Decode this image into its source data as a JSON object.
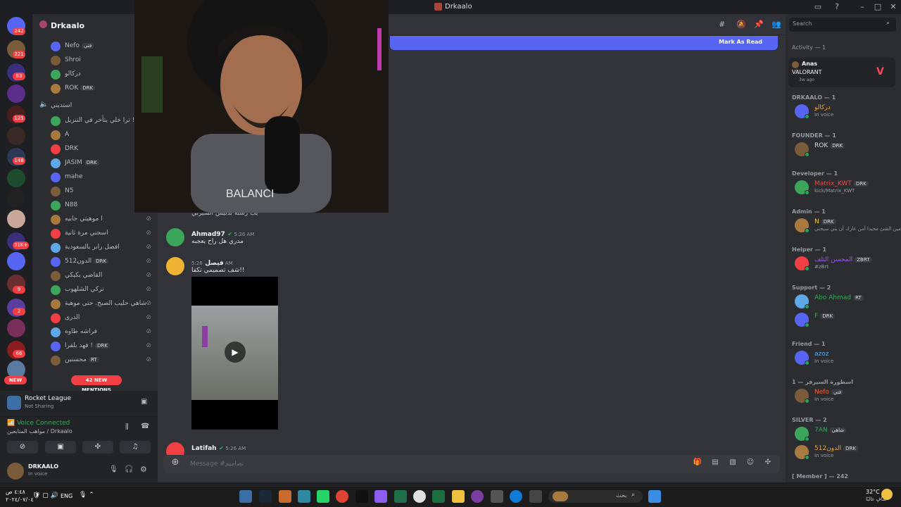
{
  "window": {
    "title": "Drkaalo",
    "minimize": "–",
    "maximize": "□",
    "close": "✕"
  },
  "rail": {
    "home_badge": "242",
    "badges": [
      "221",
      "83",
      "125",
      "148",
      "31K+",
      "9",
      "2",
      "66"
    ],
    "new_label": "NEW",
    "mentions_label": "42 NEW MENTIONS"
  },
  "sidebar": {
    "guild_name": "Drkaalo",
    "top_users": [
      {
        "name": "Nefo",
        "tag": "فتي"
      },
      {
        "name": "Shroi",
        "tag": ""
      },
      {
        "name": "دركالو",
        "tag": ""
      },
      {
        "name": "ROK",
        "tag": "DRK"
      }
    ],
    "voice_channel": "استديني",
    "voice_users": [
      {
        "name": "ترا خلي يتأخر في التنزيل !",
        "tag": "RT",
        "muted": false
      },
      {
        "name": "A",
        "tag": "",
        "muted": false
      },
      {
        "name": "DRK",
        "tag": "",
        "muted": false
      },
      {
        "name": "JASIM",
        "tag": "DRK",
        "muted": false
      },
      {
        "name": "mahe",
        "tag": "",
        "muted": false
      },
      {
        "name": "N5",
        "tag": "",
        "muted": false
      },
      {
        "name": "N88",
        "tag": "",
        "muted": false
      },
      {
        "name": "ا موهيتي حابيه",
        "tag": "",
        "muted": true
      },
      {
        "name": "اسجني مرة ثانية",
        "tag": "",
        "muted": true
      },
      {
        "name": "افضل رابر بالسعودية",
        "tag": "",
        "muted": true
      },
      {
        "name": "الدون512",
        "tag": "DRK",
        "muted": true
      },
      {
        "name": "القاضي بكيكي",
        "tag": "",
        "muted": true
      },
      {
        "name": "تركي الشلهوب",
        "tag": "",
        "muted": true
      },
      {
        "name": "شاهي حليب الصبح. حتى موهية",
        "tag": "",
        "muted": true
      },
      {
        "name": "الدرى",
        "tag": "",
        "muted": true
      },
      {
        "name": "فراشه طاوه",
        "tag": "",
        "muted": true
      },
      {
        "name": "فهد بلقرا !",
        "tag": "DRK",
        "muted": true
      },
      {
        "name": "محسنين",
        "tag": "RT",
        "muted": true
      }
    ],
    "activity_panel": {
      "game": "Rocket League",
      "status": "Not Sharing"
    },
    "voice_panel": {
      "status": "Voice Connected",
      "channel": "مواهب المتابعين / Drkaalo"
    },
    "user_panel": {
      "name": "DRKAALO",
      "status": "In voice"
    }
  },
  "chat": {
    "mark_as_read": "Mark As Read",
    "partial_text": "يب رشنة بدليس السيرني",
    "messages": [
      {
        "author": "Ahmad97",
        "time": "5:26 AM",
        "text": "مدري هل راح يعجبه"
      },
      {
        "author": "فيصل",
        "time": "5:26 AM",
        "text": "شف تصميمي تكفا!!"
      },
      {
        "author": "Latifah",
        "time": "5:26 AM",
        "text": ""
      }
    ],
    "composer_placeholder": "Message #تصاميم"
  },
  "members": {
    "search_placeholder": "Search",
    "activity_header": "Activity — 1",
    "activity": {
      "name": "Anas",
      "game": "VALORANT",
      "time": "3w ago"
    },
    "groups": [
      {
        "header": "DRKAALO — 1",
        "members": [
          {
            "name": "دركالو",
            "sub": "In voice",
            "color": "#f0a33a",
            "tag": ""
          }
        ]
      },
      {
        "header": "FOUNDER — 1",
        "members": [
          {
            "name": "ROK",
            "sub": "",
            "color": "#dbdee1",
            "tag": "DRK"
          }
        ]
      },
      {
        "header": "Developer — 1",
        "members": [
          {
            "name": "Matrix_KWT",
            "sub": "kick/Matrix_KWT",
            "color": "#e84a4a",
            "tag": "DRK"
          }
        ]
      },
      {
        "header": "Admin — 1",
        "members": [
          {
            "name": "N",
            "sub": "مين الشئ مجيدا أمن عارك أن يني سيحني",
            "color": "#f0d33a",
            "tag": "DRK"
          }
        ]
      },
      {
        "header": "Helper — 1",
        "members": [
          {
            "name": "المحسن التلف",
            "sub": "#zBrt",
            "color": "#9b59f0",
            "tag": "ZBRT"
          }
        ]
      },
      {
        "header": "Support — 2",
        "members": [
          {
            "name": "Abo Ahmad",
            "sub": "",
            "color": "#3ba55c",
            "tag": "RT"
          },
          {
            "name": "F",
            "sub": "",
            "color": "#3ba55c",
            "tag": "DRK"
          }
        ]
      },
      {
        "header": "Friend — 1",
        "members": [
          {
            "name": "azoz",
            "sub": "In voice",
            "color": "#5fa8e8",
            "tag": ""
          }
        ]
      },
      {
        "header": "اسطورة السيرفر — 1",
        "members": [
          {
            "name": "Nefo",
            "sub": "In voice",
            "color": "#e8643a",
            "tag": "فتي"
          }
        ]
      },
      {
        "header": "SILVER — 2",
        "members": [
          {
            "name": "7AN",
            "sub": "",
            "color": "#3ba55c",
            "tag": "شاهي"
          },
          {
            "name": "الدون512",
            "sub": "In voice",
            "color": "#f0a33a",
            "tag": "DRK"
          }
        ]
      },
      {
        "header": "[ Member ] — 242",
        "members": []
      }
    ]
  },
  "taskbar": {
    "clock_time": "٤:٤٨ ص",
    "clock_date": "٢٠٢٤/٠٧/٠٤",
    "lang": "ENG",
    "weather_temp": "32°C",
    "weather_desc": "صافٍ غالبًا",
    "search_placeholder": "بحث"
  }
}
